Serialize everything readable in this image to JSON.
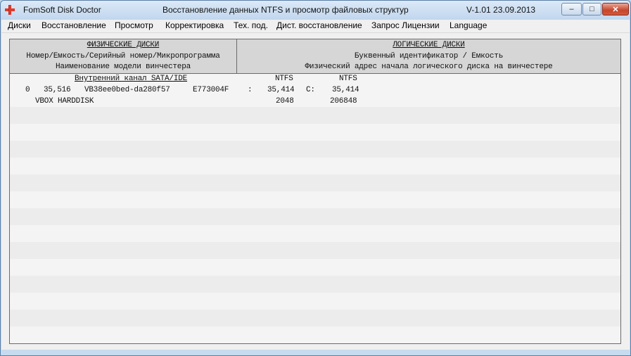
{
  "titlebar": {
    "app_name": "FomSoft Disk Doctor",
    "subtitle": "Восстановление данных NTFS и просмотр файловых структур",
    "version": "V-1.01  23.09.2013",
    "minimize": "–",
    "maximize": "□",
    "close": "✕"
  },
  "menu": [
    "Диски",
    "Восстановление",
    "Просмотр",
    "Корректировка",
    "Тех. под.",
    "Дист. восстановление",
    "Запрос Лицензии",
    "Language"
  ],
  "physical_header": {
    "title": "ФИЗИЧЕСКИЕ ДИСКИ",
    "line2": "Номер/Емкость/Серийный номер/Микропрограмма",
    "line3": "Наименование модели винчестера"
  },
  "logical_header": {
    "title": "ЛОГИЧЕСКИЕ ДИСКИ",
    "line2": "Буквенный идентификатор / Емкость",
    "line3": "Физический адрес начала логического диска на винчестере"
  },
  "channel": {
    "label": "Внутренний канал SATA/IDE",
    "fs1": "NTFS",
    "fs2": "NTFS"
  },
  "disk": {
    "number": "0",
    "capacity": "35,516",
    "serial": "VB38ee0bed-da280f57",
    "firmware": "E773004F",
    "sep": ":",
    "part1_size": "35,414",
    "part2_letter": "C:",
    "part2_size": "35,414",
    "model": "VBOX HARDDISK",
    "part1_addr": "2048",
    "part2_addr": "206848"
  },
  "colors": {
    "titlebar": "#c1d6ee",
    "panel_header": "#d6d6d6",
    "panel_bg": "#f4f4f4",
    "icon_red": "#e03a2a"
  },
  "icons": {
    "app": "red-cross-icon"
  }
}
